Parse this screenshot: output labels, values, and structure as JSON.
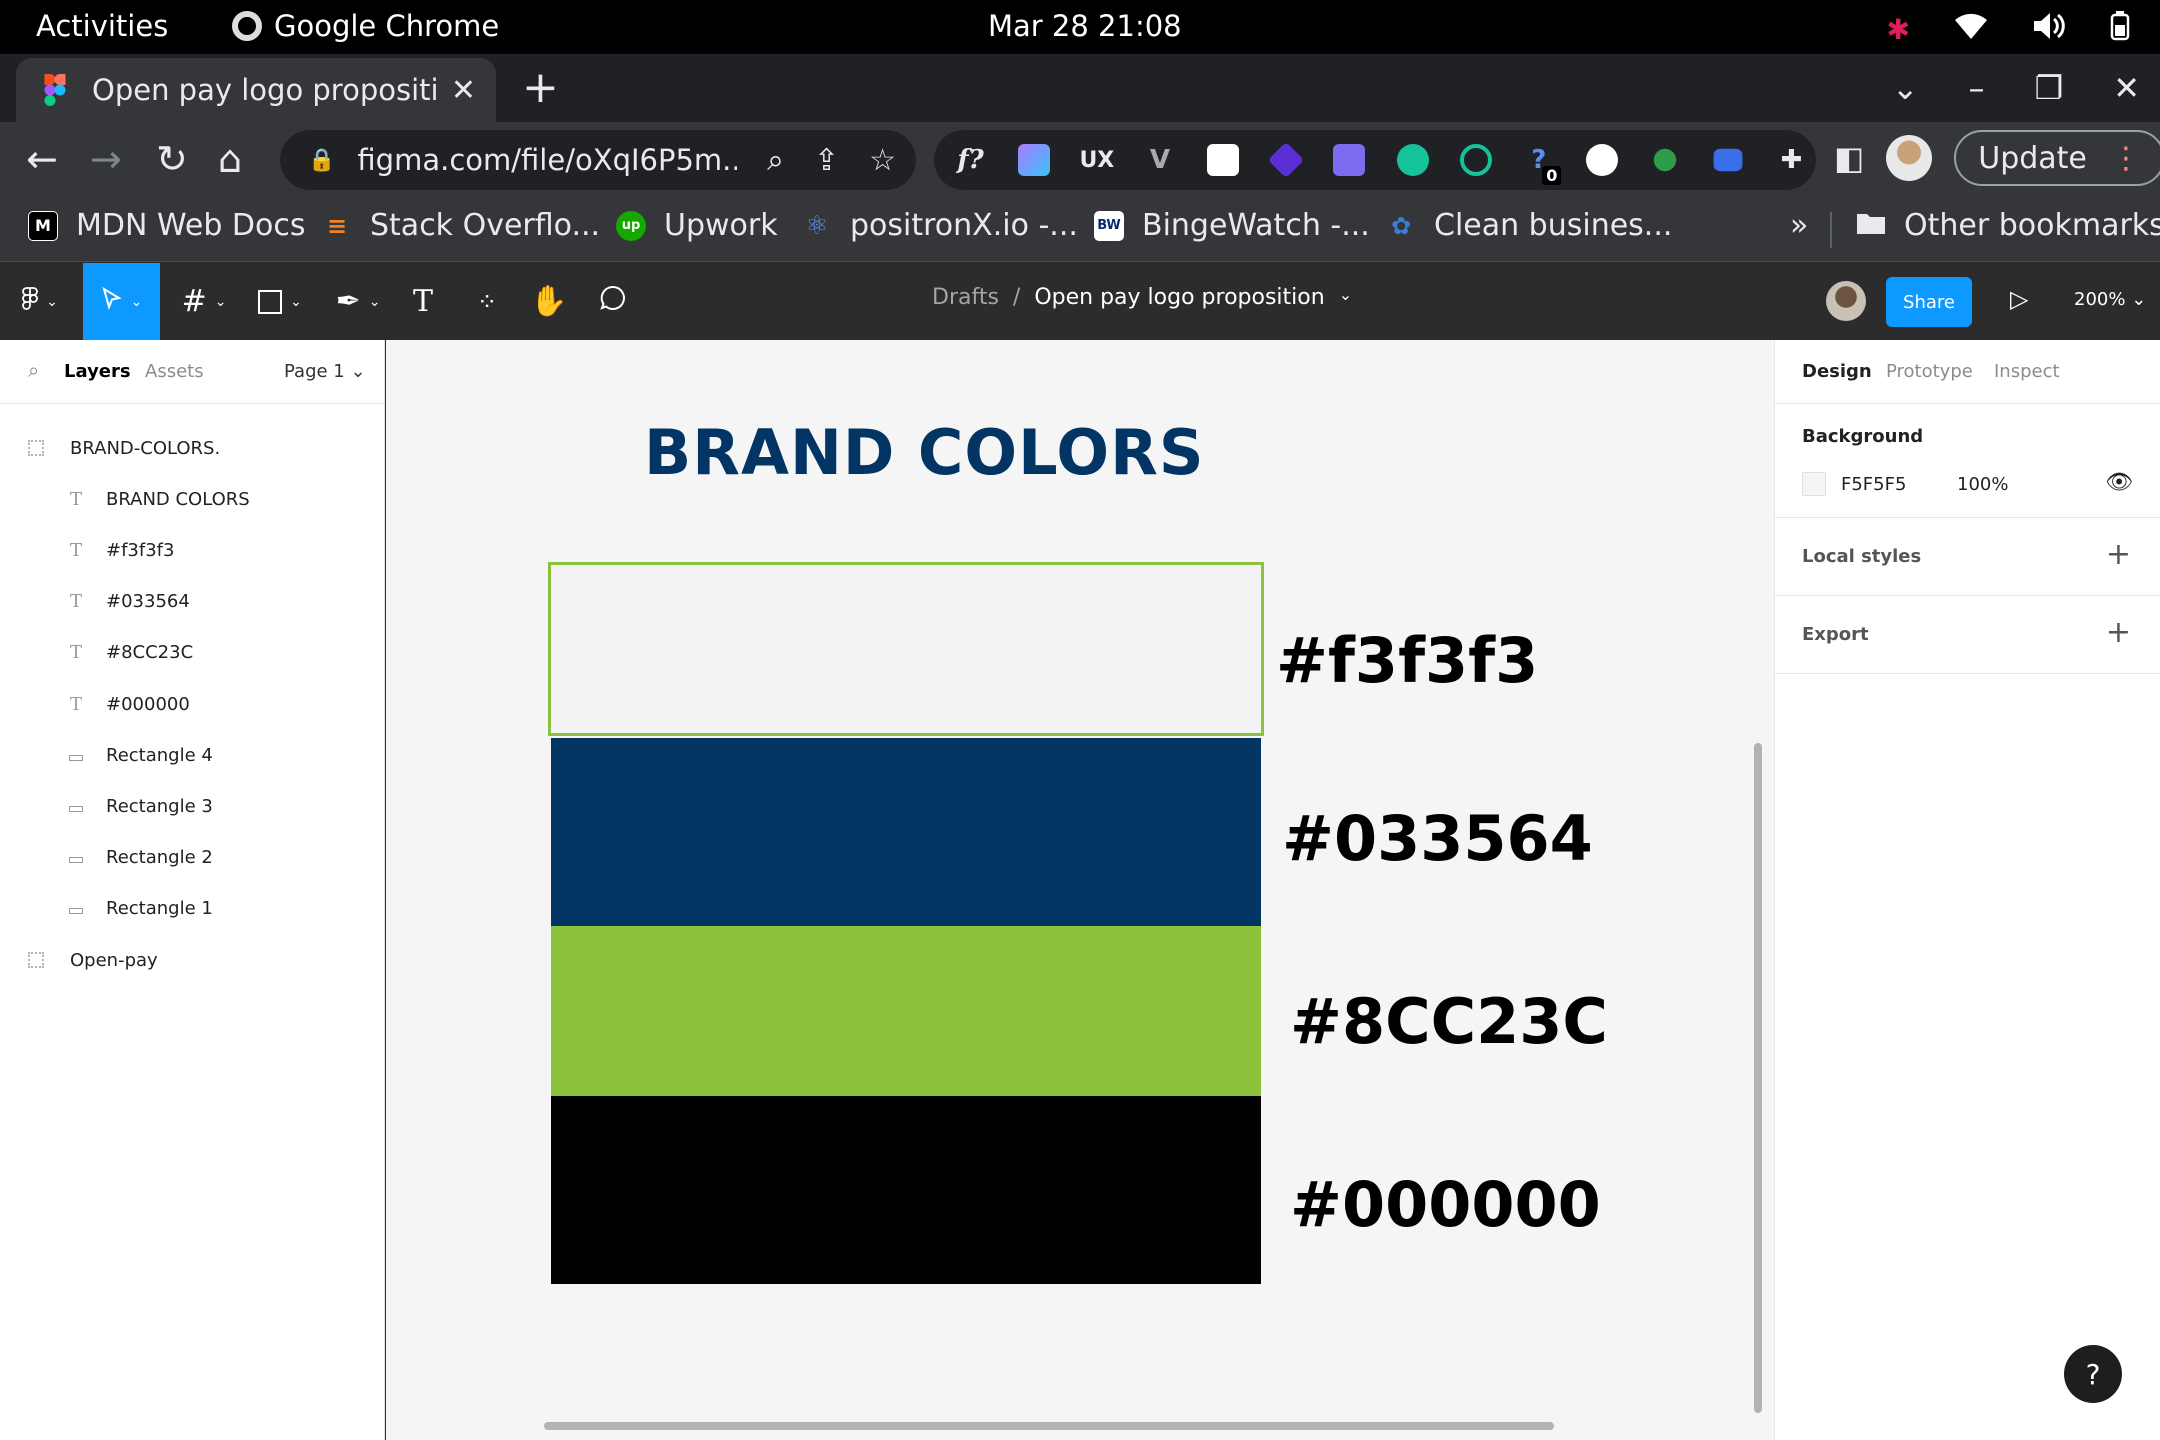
{
  "os": {
    "activities": "Activities",
    "app_name": "Google Chrome",
    "clock": "Mar 28  21:08"
  },
  "browser": {
    "tab_title": "Open pay logo propositio",
    "url": "figma.com/file/oXqI6P5m...",
    "update_label": "Update",
    "extension_badge": "0",
    "bookmarks": [
      {
        "label": "MDN Web Docs",
        "icon": "mdn-icon",
        "color": "#000000"
      },
      {
        "label": "Stack Overflo...",
        "icon": "stackoverflow-icon",
        "color": "#f48024"
      },
      {
        "label": "Upwork",
        "icon": "upwork-icon",
        "color": "#14a800"
      },
      {
        "label": "positronX.io -...",
        "icon": "positronx-icon",
        "color": "#5a4fcf"
      },
      {
        "label": "BingeWatch -...",
        "icon": "bingewatch-icon",
        "color": "#0b2a6b"
      },
      {
        "label": "Clean busines...",
        "icon": "clean-business-icon",
        "color": "#3b7ddd"
      }
    ],
    "other_bookmarks": "Other bookmarks"
  },
  "figma": {
    "breadcrumb_parent": "Drafts",
    "breadcrumb_sep": "/",
    "file_name": "Open pay logo proposition",
    "share_label": "Share",
    "zoom": "200%",
    "left_panel": {
      "tab_layers": "Layers",
      "tab_assets": "Assets",
      "page": "Page 1",
      "layers": [
        {
          "name": "BRAND-COLORS.",
          "type": "frame"
        },
        {
          "name": "BRAND COLORS",
          "type": "text"
        },
        {
          "name": "#f3f3f3",
          "type": "text"
        },
        {
          "name": "#033564",
          "type": "text"
        },
        {
          "name": "#8CC23C",
          "type": "text"
        },
        {
          "name": "#000000",
          "type": "text"
        },
        {
          "name": "Rectangle 4",
          "type": "rectangle"
        },
        {
          "name": "Rectangle 3",
          "type": "rectangle"
        },
        {
          "name": "Rectangle 2",
          "type": "rectangle"
        },
        {
          "name": "Rectangle 1",
          "type": "rectangle"
        },
        {
          "name": "Open-pay",
          "type": "frame"
        }
      ]
    },
    "canvas": {
      "title": "BRAND COLORS",
      "title_color": "#033564",
      "swatches": [
        {
          "label": "#f3f3f3",
          "color": "#f3f3f3",
          "selected": true
        },
        {
          "label": "#033564",
          "color": "#033564"
        },
        {
          "label": "#8CC23C",
          "color": "#8cc23c"
        },
        {
          "label": "#000000",
          "color": "#000000"
        }
      ]
    },
    "right_panel": {
      "tab_design": "Design",
      "tab_prototype": "Prototype",
      "tab_inspect": "Inspect",
      "background_title": "Background",
      "background_hex": "F5F5F5",
      "background_opacity": "100%",
      "local_styles": "Local styles",
      "export": "Export"
    },
    "help": "?"
  }
}
